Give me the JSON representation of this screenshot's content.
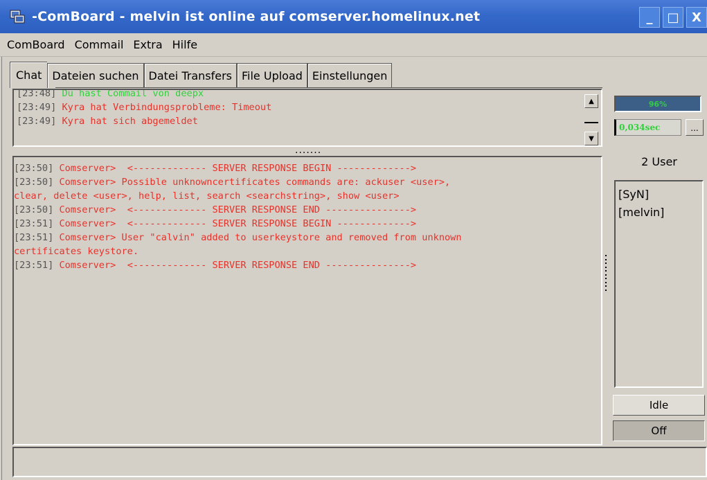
{
  "window": {
    "title": "-ComBoard  - melvin ist online auf comserver.homelinux.net",
    "buttons": {
      "minimize": "_",
      "maximize": "□",
      "close": "X"
    }
  },
  "menu": [
    "ComBoard",
    "Commail",
    "Extra",
    "Hilfe"
  ],
  "tabs": [
    {
      "label": "Chat",
      "active": true
    },
    {
      "label": "Dateien suchen"
    },
    {
      "label": "Datei Transfers"
    },
    {
      "label": "File Upload"
    },
    {
      "label": "Einstellungen"
    }
  ],
  "upper_log": [
    {
      "time": "[23:48]",
      "text": " Du hast Commail von deepx",
      "color": "green"
    },
    {
      "time": "[23:49]",
      "text": " Kyra hat Verbindungsprobleme: Timeout",
      "color": "red"
    },
    {
      "time": "[23:49]",
      "text": " Kyra hat sich abgemeldet",
      "color": "red"
    }
  ],
  "splitter_dots": ".......",
  "lower_log": [
    {
      "time": "[23:50]",
      "text": " Comserver>  <------------- SERVER RESPONSE BEGIN ------------->"
    },
    {
      "time": "[23:50]",
      "text": " Comserver> Possible unknowncertificates commands are: ackuser <user>,"
    },
    {
      "time": "",
      "text": "clear, delete <user>, help, list, search <searchstring>, show <user>"
    },
    {
      "time": "[23:50]",
      "text": " Comserver>  <------------- SERVER RESPONSE END --------------->"
    },
    {
      "time": "[23:51]",
      "text": " Comserver>  <------------- SERVER RESPONSE BEGIN ------------->"
    },
    {
      "time": "[23:51]",
      "text": " Comserver> User \"calvin\" added to userkeystore and removed from unknown"
    },
    {
      "time": "",
      "text": "certificates keystore."
    },
    {
      "time": "[23:51]",
      "text": " Comserver>  <------------- SERVER RESPONSE END --------------->"
    }
  ],
  "status_panel": {
    "progress_label": "96%",
    "latency": "0,034sec",
    "more_button": "...",
    "user_count": "2 User",
    "users": [
      "[SyN]",
      "[melvin]"
    ],
    "idle_button": "Idle",
    "off_button": "Off"
  },
  "colors": {
    "title_bar": "#3569c9",
    "log_red": "#e8322a",
    "log_green": "#2fd23a",
    "window_bg": "#d4d0c8"
  },
  "icons": {
    "app": "comboard-app-icon"
  }
}
